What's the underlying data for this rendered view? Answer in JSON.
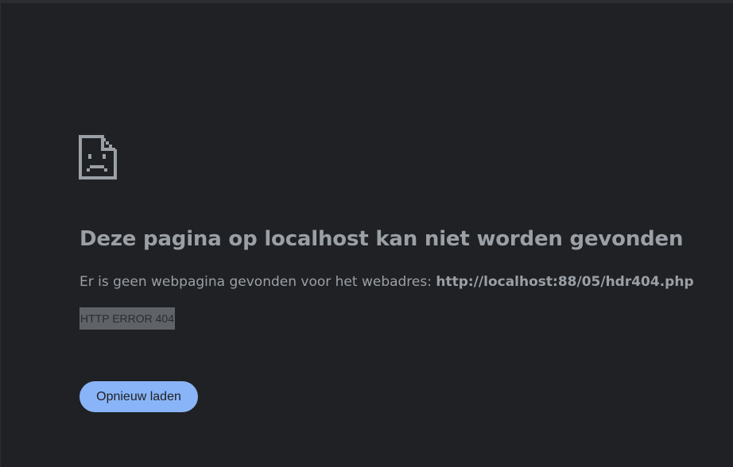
{
  "error_page": {
    "icon": "sad-document-icon",
    "title": "Deze pagina op localhost kan niet worden gevonden",
    "description_prefix": "Er is geen webpagina gevonden voor het webadres:",
    "url": "http://localhost:88/05/hdr404.php",
    "error_code": "HTTP ERROR 404",
    "reload_label": "Opnieuw laden"
  },
  "colors": {
    "background": "#202124",
    "text": "#9aa0a6",
    "button": "#8ab4f8",
    "error_code_highlight": "#5f6368"
  }
}
